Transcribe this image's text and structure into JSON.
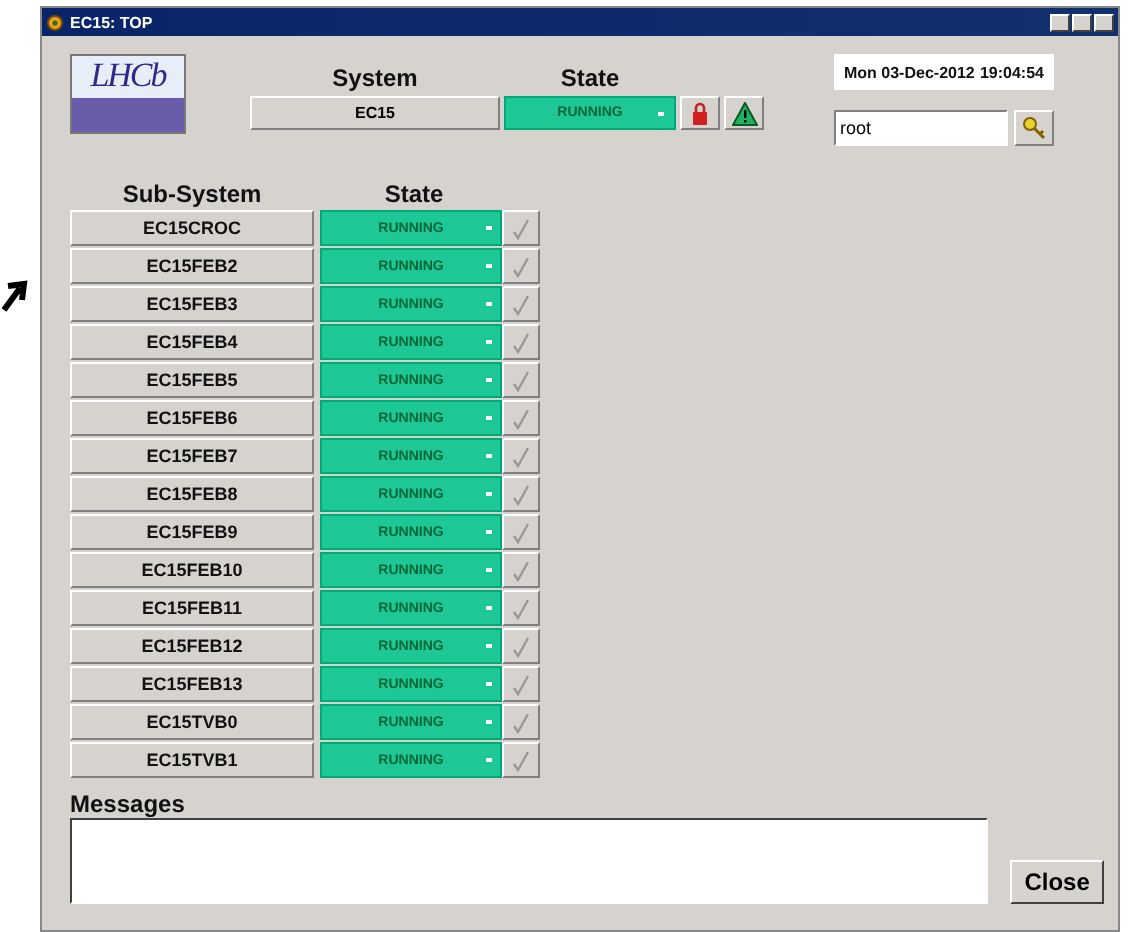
{
  "window": {
    "title": "EC15: TOP"
  },
  "logo": {
    "text": "LHCb"
  },
  "system": {
    "label": "System",
    "value": "EC15",
    "state_label": "State",
    "state": "RUNNING"
  },
  "clock": {
    "date": "Mon 03-Dec-2012",
    "time": "19:04:54"
  },
  "user": {
    "value": "root"
  },
  "table": {
    "columns": [
      "Sub-System",
      "State"
    ],
    "rows": [
      {
        "name": "EC15CROC",
        "state": "RUNNING"
      },
      {
        "name": "EC15FEB2",
        "state": "RUNNING"
      },
      {
        "name": "EC15FEB3",
        "state": "RUNNING"
      },
      {
        "name": "EC15FEB4",
        "state": "RUNNING"
      },
      {
        "name": "EC15FEB5",
        "state": "RUNNING"
      },
      {
        "name": "EC15FEB6",
        "state": "RUNNING"
      },
      {
        "name": "EC15FEB7",
        "state": "RUNNING"
      },
      {
        "name": "EC15FEB8",
        "state": "RUNNING"
      },
      {
        "name": "EC15FEB9",
        "state": "RUNNING"
      },
      {
        "name": "EC15FEB10",
        "state": "RUNNING"
      },
      {
        "name": "EC15FEB11",
        "state": "RUNNING"
      },
      {
        "name": "EC15FEB12",
        "state": "RUNNING"
      },
      {
        "name": "EC15FEB13",
        "state": "RUNNING"
      },
      {
        "name": "EC15TVB0",
        "state": "RUNNING"
      },
      {
        "name": "EC15TVB1",
        "state": "RUNNING"
      }
    ]
  },
  "messages": {
    "label": "Messages"
  },
  "buttons": [
    "Close"
  ]
}
